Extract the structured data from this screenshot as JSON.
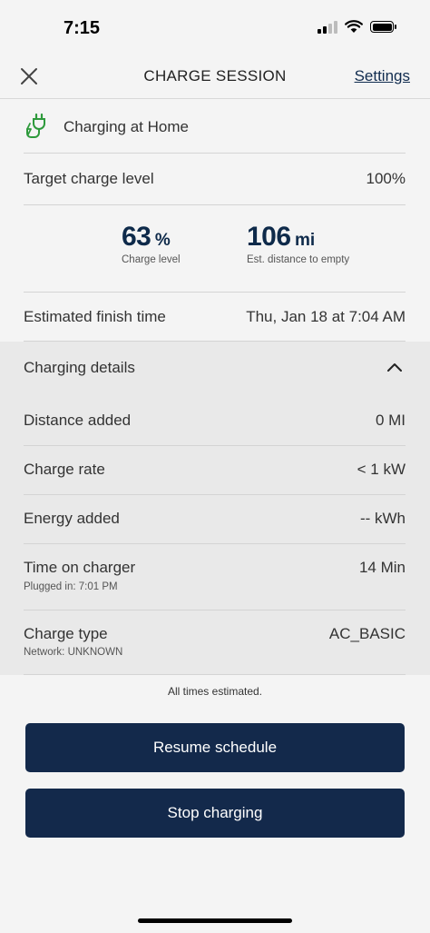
{
  "status_bar": {
    "time": "7:15"
  },
  "header": {
    "title": "CHARGE SESSION",
    "settings_label": "Settings"
  },
  "location": {
    "label": "Charging at Home"
  },
  "target": {
    "label": "Target charge level",
    "value": "100%"
  },
  "stats": {
    "charge_level": {
      "number": "63",
      "unit": "%",
      "caption": "Charge level"
    },
    "distance": {
      "number": "106",
      "unit": "mi",
      "caption": "Est. distance to empty"
    }
  },
  "finish": {
    "label": "Estimated finish time",
    "value": "Thu, Jan 18 at 7:04 AM"
  },
  "details": {
    "title": "Charging details",
    "rows": [
      {
        "label": "Distance added",
        "value": "0 MI"
      },
      {
        "label": "Charge rate",
        "value": "< 1 kW"
      },
      {
        "label": "Energy added",
        "value": "-- kWh"
      },
      {
        "label": "Time on charger",
        "value": "14 Min",
        "sub": "Plugged in: 7:01 PM"
      },
      {
        "label": "Charge type",
        "value": "AC_BASIC",
        "sub": "Network: UNKNOWN"
      }
    ]
  },
  "note": "All times estimated.",
  "buttons": {
    "resume": "Resume schedule",
    "stop": "Stop charging"
  },
  "colors": {
    "primary": "#13294b",
    "accent_green": "#2e9a3c",
    "background": "#f4f4f4",
    "details_bg": "#e9e9e9"
  },
  "icons": [
    "close-icon",
    "plug-icon",
    "chevron-up-icon",
    "signal-icon",
    "wifi-icon",
    "battery-icon"
  ]
}
